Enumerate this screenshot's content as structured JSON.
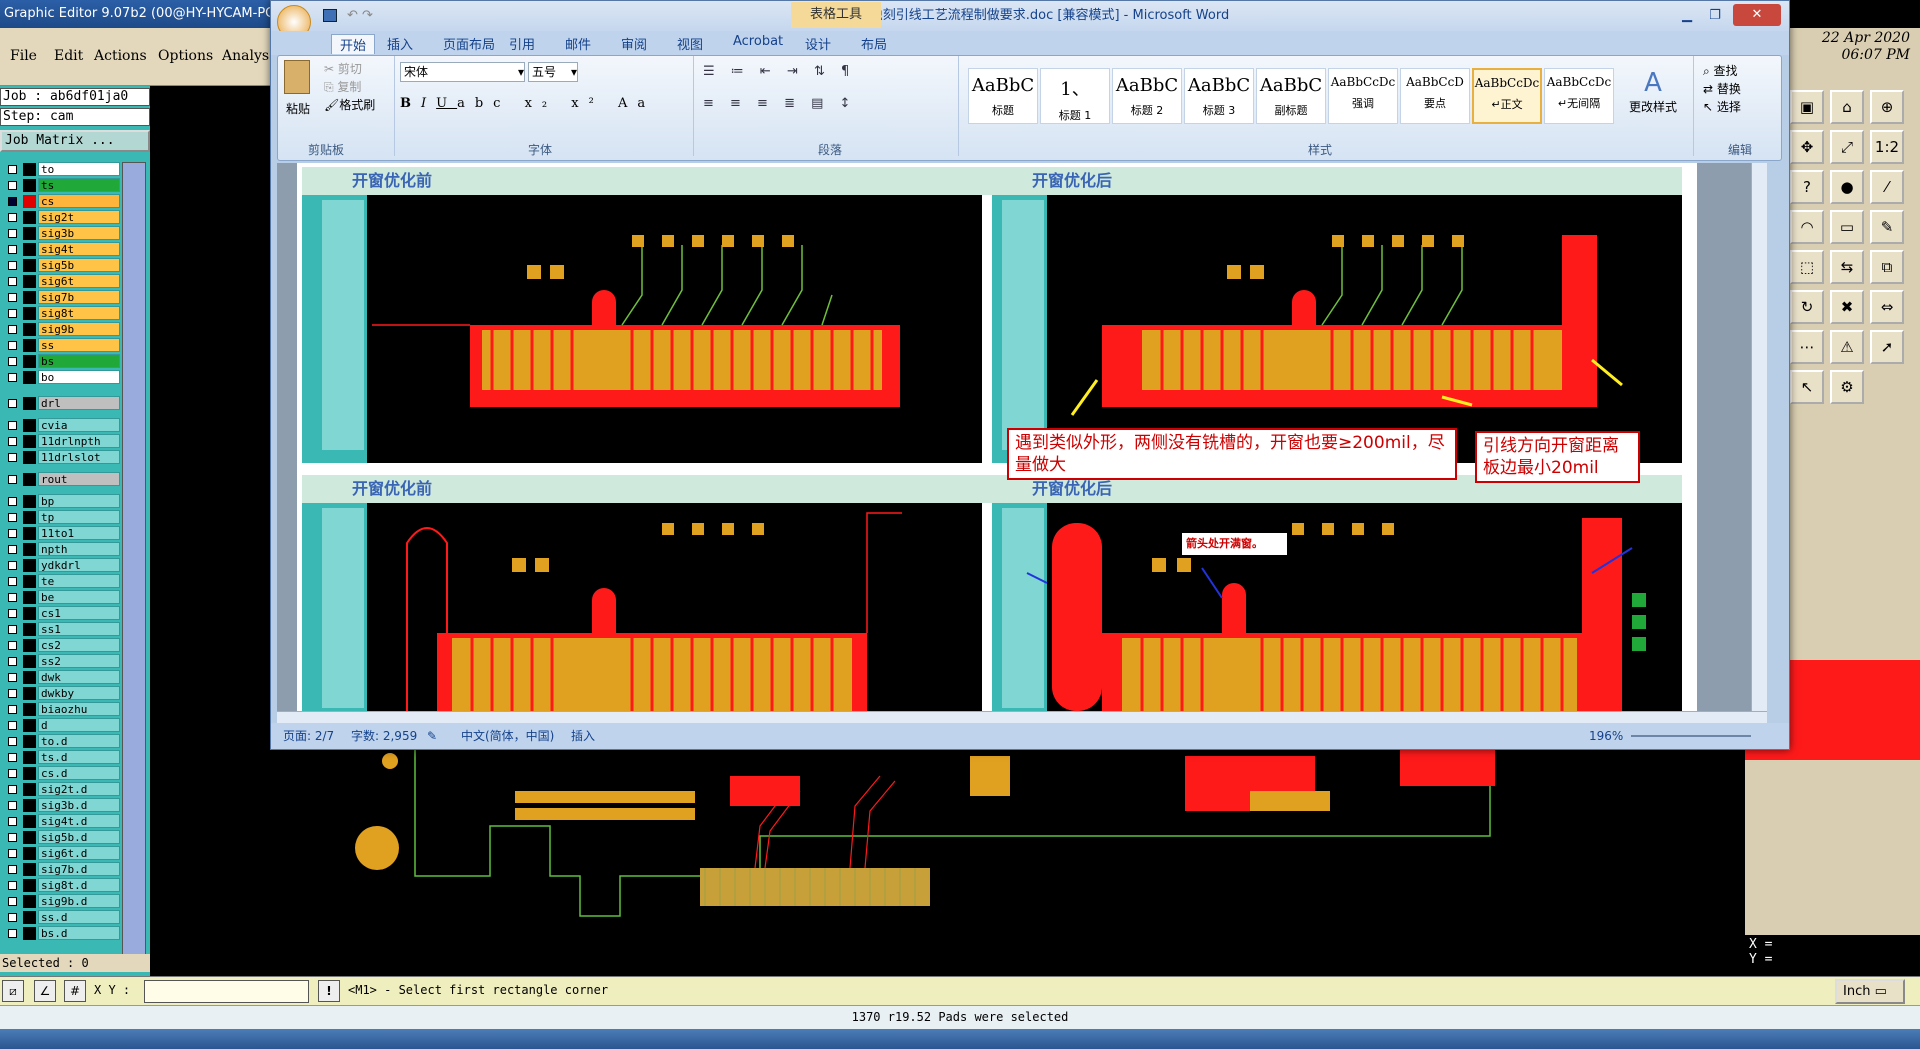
{
  "genesis": {
    "title": "Graphic Editor 9.07b2 (00@HY-HYCAM-PC",
    "menu": [
      "File",
      "Edit",
      "Actions",
      "Options",
      "Analys"
    ],
    "job": "Job : ab6df01ja0",
    "step": "Step: cam",
    "job_matrix": "Job Matrix ...",
    "layers": [
      {
        "name": "to",
        "color": "#ffffff",
        "checked": false
      },
      {
        "name": "ts",
        "color": "#20a838",
        "checked": false
      },
      {
        "name": "cs",
        "color": "#ffb43c",
        "swatch": "#e00000",
        "checked": true
      },
      {
        "name": "sig2t",
        "color": "#ffc447",
        "checked": false
      },
      {
        "name": "sig3b",
        "color": "#ffc447",
        "checked": false
      },
      {
        "name": "sig4t",
        "color": "#ffc447",
        "checked": false
      },
      {
        "name": "sig5b",
        "color": "#ffc447",
        "checked": false
      },
      {
        "name": "sig6t",
        "color": "#ffc447",
        "checked": false
      },
      {
        "name": "sig7b",
        "color": "#ffc447",
        "checked": false
      },
      {
        "name": "sig8t",
        "color": "#ffc447",
        "checked": false
      },
      {
        "name": "sig9b",
        "color": "#ffc447",
        "checked": false
      },
      {
        "name": "ss",
        "color": "#ffc447",
        "checked": false
      },
      {
        "name": "bs",
        "color": "#20a838",
        "checked": false
      },
      {
        "name": "bo",
        "color": "#ffffff",
        "checked": false
      },
      {
        "name": "drl",
        "color": "#bfbfbf",
        "checked": false
      },
      {
        "name": "cvia",
        "color": "#7fd6d2",
        "checked": false
      },
      {
        "name": "11drlnpth",
        "color": "#7fd6d2",
        "checked": false
      },
      {
        "name": "11drlslot",
        "color": "#7fd6d2",
        "checked": false
      },
      {
        "name": "rout",
        "color": "#bfbfbf",
        "checked": false
      },
      {
        "name": "bp",
        "color": "#7fd6d2",
        "checked": false
      },
      {
        "name": "tp",
        "color": "#7fd6d2",
        "checked": false
      },
      {
        "name": "11to1",
        "color": "#7fd6d2",
        "checked": false
      },
      {
        "name": "npth",
        "color": "#7fd6d2",
        "checked": false
      },
      {
        "name": "ydkdrl",
        "color": "#7fd6d2",
        "checked": false
      },
      {
        "name": "te",
        "color": "#7fd6d2",
        "checked": false
      },
      {
        "name": "be",
        "color": "#7fd6d2",
        "checked": false
      },
      {
        "name": "cs1",
        "color": "#7fd6d2",
        "checked": false
      },
      {
        "name": "ss1",
        "color": "#7fd6d2",
        "checked": false
      },
      {
        "name": "cs2",
        "color": "#7fd6d2",
        "checked": false
      },
      {
        "name": "ss2",
        "color": "#7fd6d2",
        "checked": false
      },
      {
        "name": "dwk",
        "color": "#7fd6d2",
        "checked": false
      },
      {
        "name": "dwkby",
        "color": "#7fd6d2",
        "checked": false
      },
      {
        "name": "biaozhu",
        "color": "#7fd6d2",
        "checked": false
      },
      {
        "name": "d",
        "color": "#7fd6d2",
        "checked": false
      },
      {
        "name": "to.d",
        "color": "#7fd6d2",
        "checked": false
      },
      {
        "name": "ts.d",
        "color": "#7fd6d2",
        "checked": false
      },
      {
        "name": "cs.d",
        "color": "#7fd6d2",
        "checked": false
      },
      {
        "name": "sig2t.d",
        "color": "#7fd6d2",
        "checked": false
      },
      {
        "name": "sig3b.d",
        "color": "#7fd6d2",
        "checked": false
      },
      {
        "name": "sig4t.d",
        "color": "#7fd6d2",
        "checked": false
      },
      {
        "name": "sig5b.d",
        "color": "#7fd6d2",
        "checked": false
      },
      {
        "name": "sig6t.d",
        "color": "#7fd6d2",
        "checked": false
      },
      {
        "name": "sig7b.d",
        "color": "#7fd6d2",
        "checked": false
      },
      {
        "name": "sig8t.d",
        "color": "#7fd6d2",
        "checked": false
      },
      {
        "name": "sig9b.d",
        "color": "#7fd6d2",
        "checked": false
      },
      {
        "name": "ss.d",
        "color": "#7fd6d2",
        "checked": false
      },
      {
        "name": "bs.d",
        "color": "#7fd6d2",
        "checked": false
      }
    ],
    "selected": "Selected : 0",
    "date": "22 Apr 2020",
    "time": "06:07 PM",
    "x_label": "X =",
    "y_label": "Y =",
    "xy_label": "X Y :",
    "xy_value": "",
    "prompt": "<M1> - Select first rectangle corner",
    "units": "Inch",
    "status": "1370 r19.52 Pads were selected",
    "tool_icons": [
      "save-icon",
      "home-icon",
      "zoom-icon",
      "pan-icon",
      "fit-icon",
      "ratio-icon",
      "help-icon",
      "pad-icon",
      "line-icon",
      "arc-icon",
      "rect-icon",
      "edit-icon",
      "select-icon",
      "move-icon",
      "copy-icon",
      "rotate-icon",
      "delete-icon",
      "measure-icon",
      "snap-icon",
      "warning-icon",
      "pointer-icon",
      "cursor-icon",
      "gear-icon"
    ]
  },
  "word": {
    "title": "金手指蚀刻引线工艺流程制做要求.doc [兼容模式] - Microsoft Word",
    "context_tab": "表格工具",
    "tabs": [
      "开始",
      "插入",
      "页面布局",
      "引用",
      "邮件",
      "审阅",
      "视图",
      "Acrobat",
      "设计",
      "布局"
    ],
    "clipboard": {
      "paste": "粘贴",
      "cut": "剪切",
      "copy": "复制",
      "format_painter": "格式刷",
      "label": "剪贴板"
    },
    "font": {
      "name": "宋体",
      "size": "五号",
      "label": "字体"
    },
    "paragraph_label": "段落",
    "styles": [
      {
        "preview": "AaBbC",
        "name": "标题"
      },
      {
        "preview": "1、",
        "name": "标题 1"
      },
      {
        "preview": "AaBbC",
        "name": "标题 2"
      },
      {
        "preview": "AaBbC",
        "name": "标题 3"
      },
      {
        "preview": "AaBbC",
        "name": "副标题"
      },
      {
        "preview": "AaBbCcDc",
        "name": "强调"
      },
      {
        "preview": "AaBbCcD",
        "name": "要点"
      },
      {
        "preview": "AaBbCcDc",
        "name": "↵正文"
      },
      {
        "preview": "AaBbCcDc",
        "name": "↵无间隔"
      }
    ],
    "styles_label": "样式",
    "change_styles": "更改样式",
    "editing": {
      "find": "查找",
      "replace": "替换",
      "select": "选择",
      "label": "编辑"
    },
    "doc": {
      "before_1": "开窗优化前",
      "after_1": "开窗优化后",
      "before_2": "开窗优化前",
      "after_2": "开窗优化后",
      "callout_1": "遇到类似外形，两侧没有铣槽的，开窗也要≥200mil，尽量做大",
      "callout_2": "引线方向开窗距离板边最小20mil",
      "note": "箭头处开满窗。"
    },
    "status": {
      "page": "页面: 2/7",
      "words": "字数: 2,959",
      "lang": "中文(简体，中国)",
      "mode": "插入",
      "zoom": "196%"
    }
  },
  "colors": {
    "copper": "#e0a020",
    "mask_red": "#ff1a1a",
    "trace_green": "#6fbf3c",
    "header_green": "#cfe9dd"
  }
}
